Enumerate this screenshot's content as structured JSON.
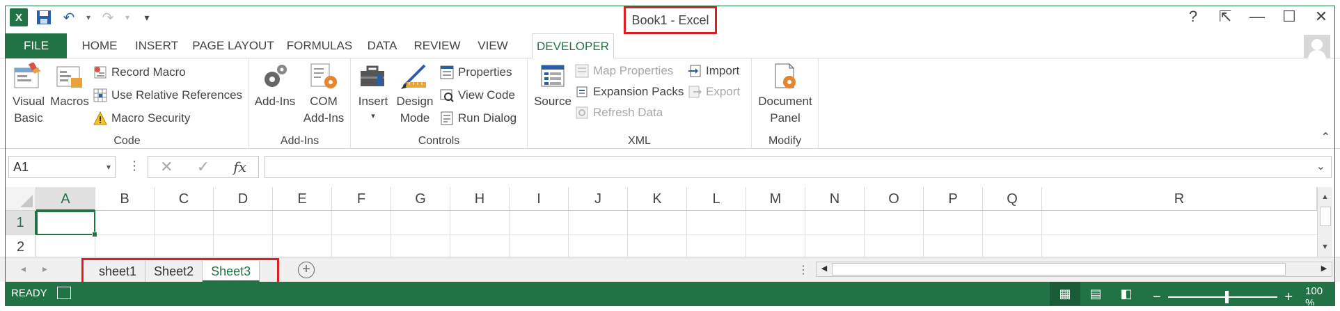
{
  "window": {
    "title": "Book1 - Excel",
    "controls": {
      "help": "?",
      "restore_ribbon": "⇱",
      "minimize": "—",
      "maximize": "☐",
      "close": "✕"
    }
  },
  "qat": {
    "undo_icon": "↶",
    "redo_icon": "↷",
    "customize": "▾",
    "save_icon": "floppy-disk"
  },
  "excel_logo_text": "X",
  "tabs": [
    "FILE",
    "HOME",
    "INSERT",
    "PAGE LAYOUT",
    "FORMULAS",
    "DATA",
    "REVIEW",
    "VIEW",
    "DEVELOPER"
  ],
  "active_tab": "DEVELOPER",
  "ribbon": {
    "code": {
      "label": "Code",
      "visual_basic": [
        "Visual",
        "Basic"
      ],
      "macros": "Macros",
      "record_macro": "Record Macro",
      "relative_refs": "Use Relative References",
      "macro_security": "Macro Security"
    },
    "addins": {
      "label": "Add-Ins",
      "addins": "Add-Ins",
      "com_addins": [
        "COM",
        "Add-Ins"
      ]
    },
    "controls": {
      "label": "Controls",
      "insert": "Insert",
      "design_mode": [
        "Design",
        "Mode"
      ],
      "properties": "Properties",
      "view_code": "View Code",
      "run_dialog": "Run Dialog"
    },
    "xml": {
      "label": "XML",
      "source": "Source",
      "map_properties": "Map Properties",
      "expansion_packs": "Expansion Packs",
      "refresh_data": "Refresh Data",
      "import": "Import",
      "export": "Export"
    },
    "modify": {
      "label": "Modify",
      "document_panel": [
        "Document",
        "Panel"
      ]
    },
    "collapse_icon": "⌃"
  },
  "formula_bar": {
    "name_box": "A1",
    "cancel_icon": "✕",
    "enter_icon": "✓",
    "fx": "fx",
    "formula": ""
  },
  "grid": {
    "columns": [
      "A",
      "B",
      "C",
      "D",
      "E",
      "F",
      "G",
      "H",
      "I",
      "J",
      "K",
      "L",
      "M",
      "N",
      "O",
      "P",
      "Q",
      "R"
    ],
    "rows": [
      "1",
      "2"
    ],
    "selected_column": "A",
    "selected_row": "1"
  },
  "sheets": [
    "sheet1",
    "Sheet2",
    "Sheet3"
  ],
  "active_sheet": "Sheet3",
  "status": {
    "mode": "READY",
    "zoom_minus": "−",
    "zoom_plus": "+",
    "zoom": "100 %"
  },
  "colors": {
    "accent": "#217346",
    "highlight_box": "#e02020"
  }
}
